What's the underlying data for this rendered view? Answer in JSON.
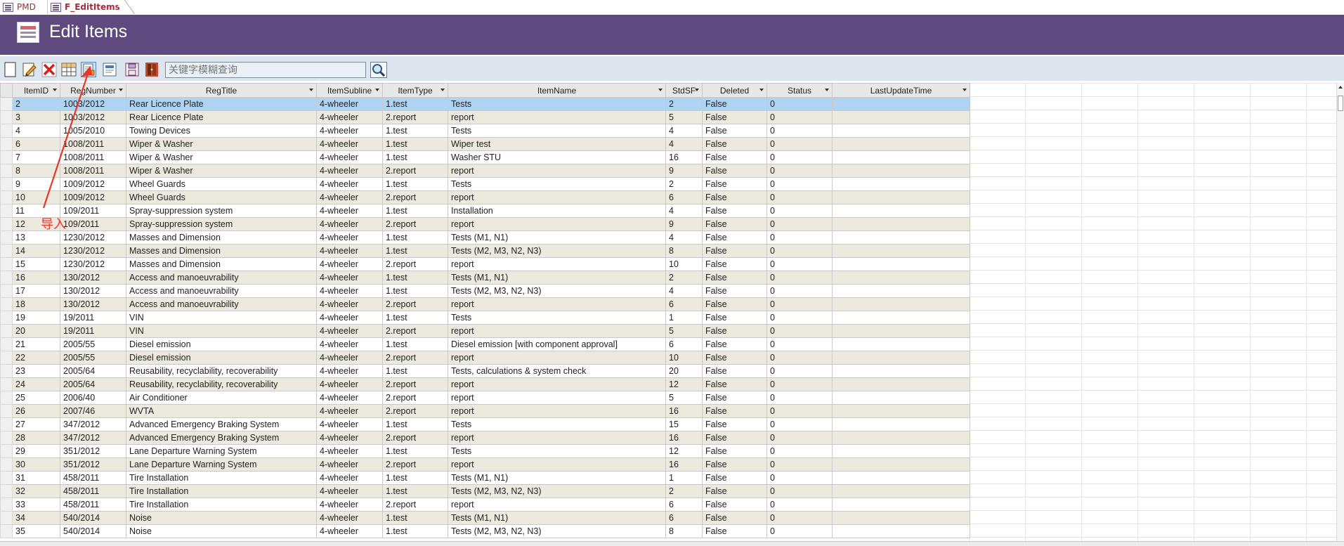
{
  "tabs": [
    {
      "label": "PMD"
    },
    {
      "label": "F_EditItems"
    }
  ],
  "header": {
    "title": "Edit Items"
  },
  "toolbar": {
    "search_placeholder": "关键字模糊查询"
  },
  "annotation": {
    "text": "导入"
  },
  "columns": [
    "ItemID",
    "RegNumber",
    "RegTitle",
    "ItemSubline",
    "ItemType",
    "ItemName",
    "StdSF",
    "Deleted",
    "Status",
    "LastUpdateTime"
  ],
  "rows": [
    [
      "2",
      "1003/2012",
      "Rear Licence Plate",
      "4-wheeler",
      "1.test",
      "Tests",
      "2",
      "False",
      "0",
      ""
    ],
    [
      "3",
      "1003/2012",
      "Rear Licence Plate",
      "4-wheeler",
      "2.report",
      "report",
      "5",
      "False",
      "0",
      ""
    ],
    [
      "4",
      "1005/2010",
      "Towing Devices",
      "4-wheeler",
      "1.test",
      "Tests",
      "4",
      "False",
      "0",
      ""
    ],
    [
      "6",
      "1008/2011",
      "Wiper & Washer",
      "4-wheeler",
      "1.test",
      "Wiper test",
      "4",
      "False",
      "0",
      ""
    ],
    [
      "7",
      "1008/2011",
      "Wiper & Washer",
      "4-wheeler",
      "1.test",
      "Washer STU",
      "16",
      "False",
      "0",
      ""
    ],
    [
      "8",
      "1008/2011",
      "Wiper & Washer",
      "4-wheeler",
      "2.report",
      "report",
      "9",
      "False",
      "0",
      ""
    ],
    [
      "9",
      "1009/2012",
      "Wheel Guards",
      "4-wheeler",
      "1.test",
      "Tests",
      "2",
      "False",
      "0",
      ""
    ],
    [
      "10",
      "1009/2012",
      "Wheel Guards",
      "4-wheeler",
      "2.report",
      "report",
      "6",
      "False",
      "0",
      ""
    ],
    [
      "11",
      "109/2011",
      "Spray-suppression system",
      "4-wheeler",
      "1.test",
      "Installation",
      "4",
      "False",
      "0",
      ""
    ],
    [
      "12",
      "109/2011",
      "Spray-suppression system",
      "4-wheeler",
      "2.report",
      "report",
      "9",
      "False",
      "0",
      ""
    ],
    [
      "13",
      "1230/2012",
      "Masses and Dimension",
      "4-wheeler",
      "1.test",
      "Tests (M1, N1)",
      "4",
      "False",
      "0",
      ""
    ],
    [
      "14",
      "1230/2012",
      "Masses and Dimension",
      "4-wheeler",
      "1.test",
      "Tests (M2, M3, N2, N3)",
      "8",
      "False",
      "0",
      ""
    ],
    [
      "15",
      "1230/2012",
      "Masses and Dimension",
      "4-wheeler",
      "2.report",
      "report",
      "10",
      "False",
      "0",
      ""
    ],
    [
      "16",
      "130/2012",
      "Access and manoeuvrability",
      "4-wheeler",
      "1.test",
      "Tests (M1, N1)",
      "2",
      "False",
      "0",
      ""
    ],
    [
      "17",
      "130/2012",
      "Access and manoeuvrability",
      "4-wheeler",
      "1.test",
      "Tests (M2, M3, N2, N3)",
      "4",
      "False",
      "0",
      ""
    ],
    [
      "18",
      "130/2012",
      "Access and manoeuvrability",
      "4-wheeler",
      "2.report",
      "report",
      "6",
      "False",
      "0",
      ""
    ],
    [
      "19",
      "19/2011",
      "VIN",
      "4-wheeler",
      "1.test",
      "Tests",
      "1",
      "False",
      "0",
      ""
    ],
    [
      "20",
      "19/2011",
      "VIN",
      "4-wheeler",
      "2.report",
      "report",
      "5",
      "False",
      "0",
      ""
    ],
    [
      "21",
      "2005/55",
      "Diesel emission",
      "4-wheeler",
      "1.test",
      "Diesel emission [with component approval]",
      "6",
      "False",
      "0",
      ""
    ],
    [
      "22",
      "2005/55",
      "Diesel emission",
      "4-wheeler",
      "2.report",
      "report",
      "10",
      "False",
      "0",
      ""
    ],
    [
      "23",
      "2005/64",
      "Reusability, recyclability, recoverability",
      "4-wheeler",
      "1.test",
      "Tests, calculations & system check",
      "20",
      "False",
      "0",
      ""
    ],
    [
      "24",
      "2005/64",
      "Reusability, recyclability, recoverability",
      "4-wheeler",
      "2.report",
      "report",
      "12",
      "False",
      "0",
      ""
    ],
    [
      "25",
      "2006/40",
      "Air Conditioner",
      "4-wheeler",
      "2.report",
      "report",
      "5",
      "False",
      "0",
      ""
    ],
    [
      "26",
      "2007/46",
      "WVTA",
      "4-wheeler",
      "2.report",
      "report",
      "16",
      "False",
      "0",
      ""
    ],
    [
      "27",
      "347/2012",
      "Advanced Emergency Braking System",
      "4-wheeler",
      "1.test",
      "Tests",
      "15",
      "False",
      "0",
      ""
    ],
    [
      "28",
      "347/2012",
      "Advanced Emergency Braking System",
      "4-wheeler",
      "2.report",
      "report",
      "16",
      "False",
      "0",
      ""
    ],
    [
      "29",
      "351/2012",
      "Lane Departure Warning System",
      "4-wheeler",
      "1.test",
      "Tests",
      "12",
      "False",
      "0",
      ""
    ],
    [
      "30",
      "351/2012",
      "Lane Departure Warning System",
      "4-wheeler",
      "2.report",
      "report",
      "16",
      "False",
      "0",
      ""
    ],
    [
      "31",
      "458/2011",
      "Tire Installation",
      "4-wheeler",
      "1.test",
      "Tests (M1, N1)",
      "1",
      "False",
      "0",
      ""
    ],
    [
      "32",
      "458/2011",
      "Tire Installation",
      "4-wheeler",
      "1.test",
      "Tests (M2, M3, N2, N3)",
      "2",
      "False",
      "0",
      ""
    ],
    [
      "33",
      "458/2011",
      "Tire Installation",
      "4-wheeler",
      "2.report",
      "report",
      "6",
      "False",
      "0",
      ""
    ],
    [
      "34",
      "540/2014",
      "Noise",
      "4-wheeler",
      "1.test",
      "Tests (M1, N1)",
      "6",
      "False",
      "0",
      ""
    ],
    [
      "35",
      "540/2014",
      "Noise",
      "4-wheeler",
      "1.test",
      "Tests (M2, M3, N2, N3)",
      "8",
      "False",
      "0",
      ""
    ]
  ],
  "colors": {
    "header_bg": "#5e4a7e",
    "selected_row": "#b1d3f2",
    "alt_row": "#ede9df",
    "annotation": "#e8352a"
  }
}
